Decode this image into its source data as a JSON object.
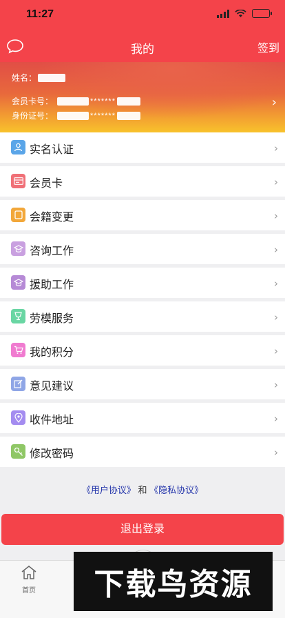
{
  "status": {
    "time": "11:27"
  },
  "nav": {
    "title": "我的",
    "checkin_label": "签到",
    "message_icon": "chat-bubble-icon"
  },
  "profile": {
    "name_label": "姓名：",
    "card_label": "会员卡号：",
    "card_stars": "*******",
    "id_label": "身份证号：",
    "id_stars": "*******"
  },
  "menu": [
    {
      "label": "实名认证",
      "icon": "user-verify-icon",
      "color": "#5aa5e8"
    },
    {
      "label": "会员卡",
      "icon": "member-card-icon",
      "color": "#f07077"
    },
    {
      "label": "会籍变更",
      "icon": "membership-change-icon",
      "color": "#f2a73a"
    },
    {
      "label": "咨询工作",
      "icon": "consult-icon",
      "color": "#c9a0e0"
    },
    {
      "label": "援助工作",
      "icon": "aid-icon",
      "color": "#b68ad6"
    },
    {
      "label": "劳模服务",
      "icon": "trophy-icon",
      "color": "#69d6a3"
    },
    {
      "label": "我的积分",
      "icon": "cart-icon",
      "color": "#f07bd0"
    },
    {
      "label": "意见建议",
      "icon": "feedback-icon",
      "color": "#8fa6e6"
    },
    {
      "label": "收件地址",
      "icon": "location-icon",
      "color": "#a48cf0"
    },
    {
      "label": "修改密码",
      "icon": "key-icon",
      "color": "#8fc766"
    }
  ],
  "agreement": {
    "user": "《用户协议》",
    "and": "和",
    "privacy": "《隐私协议》"
  },
  "logout_label": "退出登录",
  "tabbar": {
    "home_label": "首页"
  },
  "watermark": "下载鸟资源"
}
